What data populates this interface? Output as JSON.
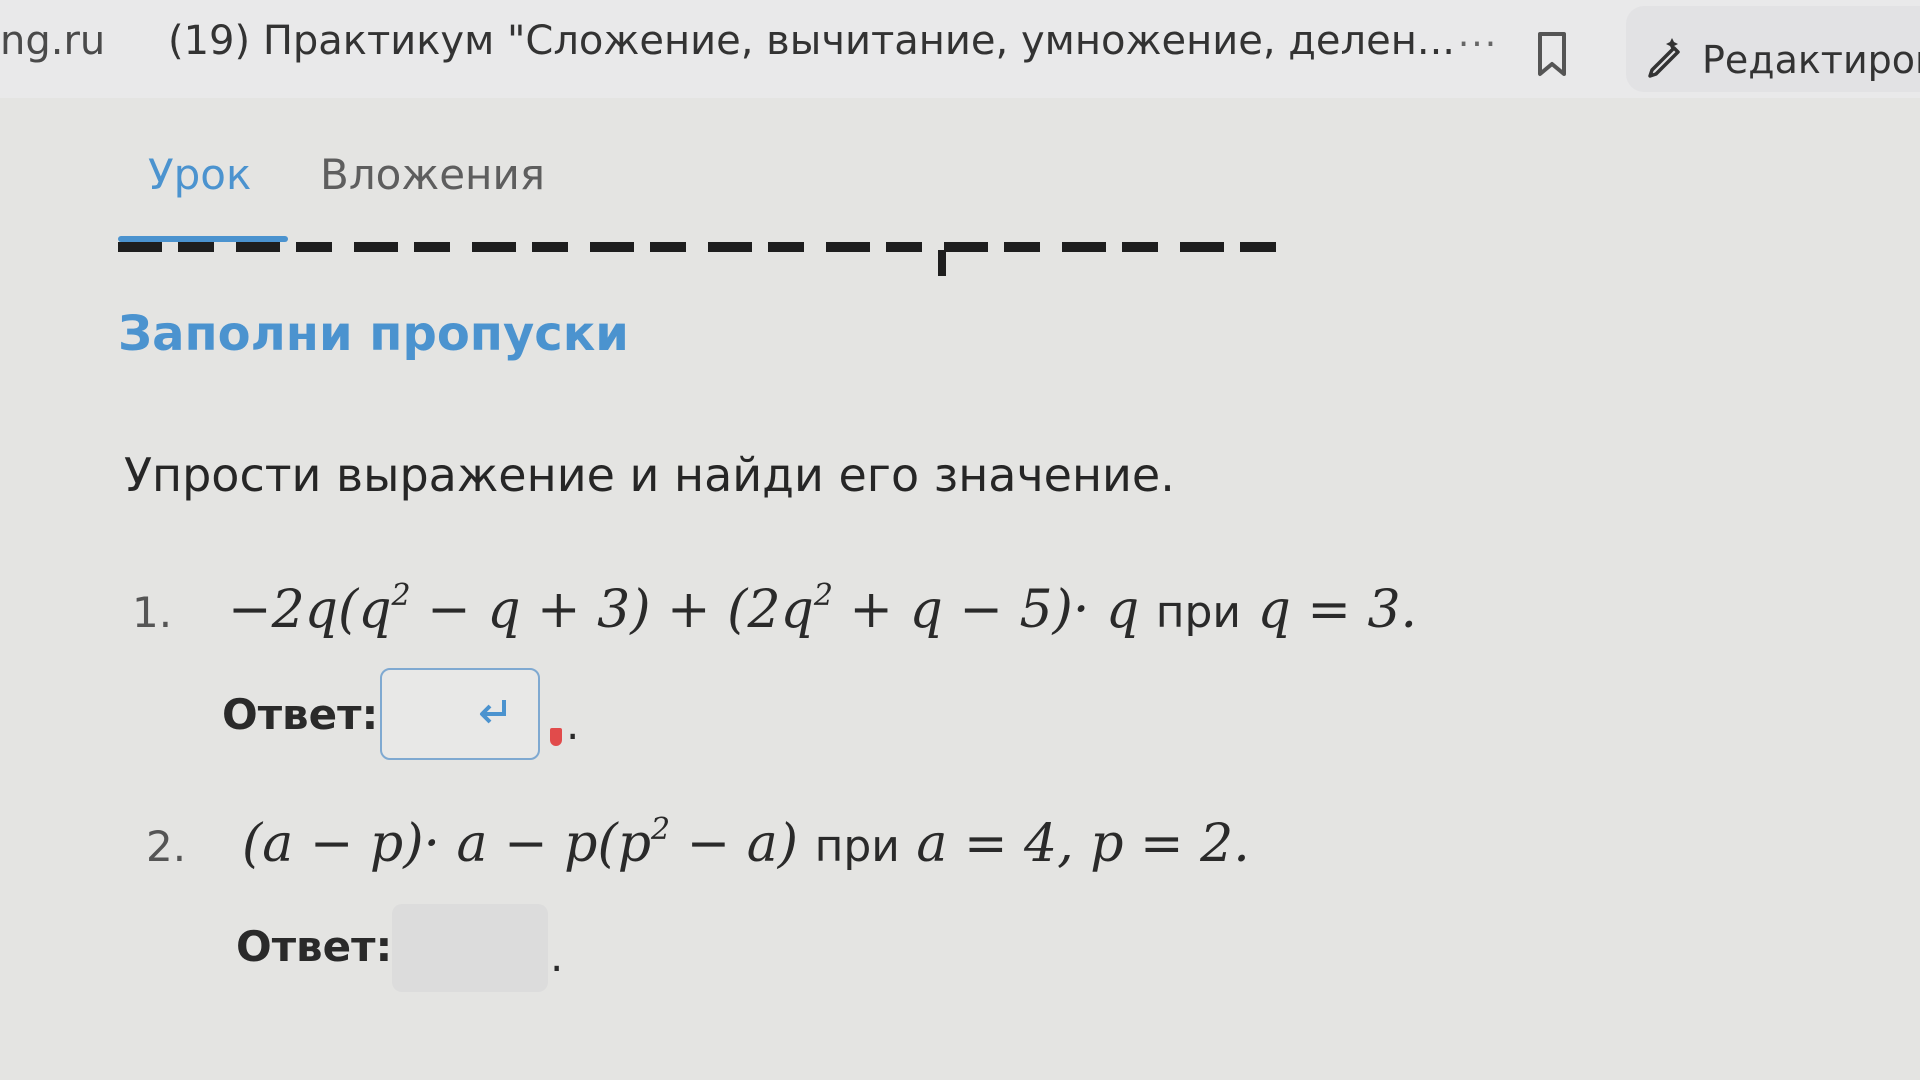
{
  "browser": {
    "site": "ng.ru",
    "doc_title": "(19) Практикум \"Сложение, вычитание, умножение, делен...",
    "more_label": "···",
    "edit_label": "Редактиров"
  },
  "tabs": [
    {
      "label": "Урок",
      "active": true
    },
    {
      "label": "Вложения",
      "active": false
    }
  ],
  "section_title": "Заполни пропуски",
  "instruction": "Упрости выражение и найди его значение.",
  "tasks": [
    {
      "number": "1.",
      "expression": "−2q(q² − q + 3) + (2q² + q − 5)· q при q = 3.",
      "expr_parts": [
        "−2q(q",
        "2",
        " − q + 3) + (2q",
        "2",
        " + q − 5)· q ",
        "при",
        " q = 3."
      ],
      "answer_label": "Ответ:",
      "answer_value": "",
      "suffix": "."
    },
    {
      "number": "2.",
      "expression": "(a − p)· a − p(p² − a) при a = 4, p = 2.",
      "expr_parts": [
        "(a − p)· a − p(p",
        "2",
        " − a) ",
        "при",
        " a = 4, p = 2."
      ],
      "answer_label": "Ответ:",
      "answer_value": "",
      "suffix": "."
    }
  ],
  "colors": {
    "accent": "#4b93cf",
    "background": "#e4e4e2",
    "marker": "#e14b4b"
  },
  "icons": [
    "more-icon",
    "bookmark-icon",
    "edit-pen-icon",
    "enter-icon"
  ]
}
